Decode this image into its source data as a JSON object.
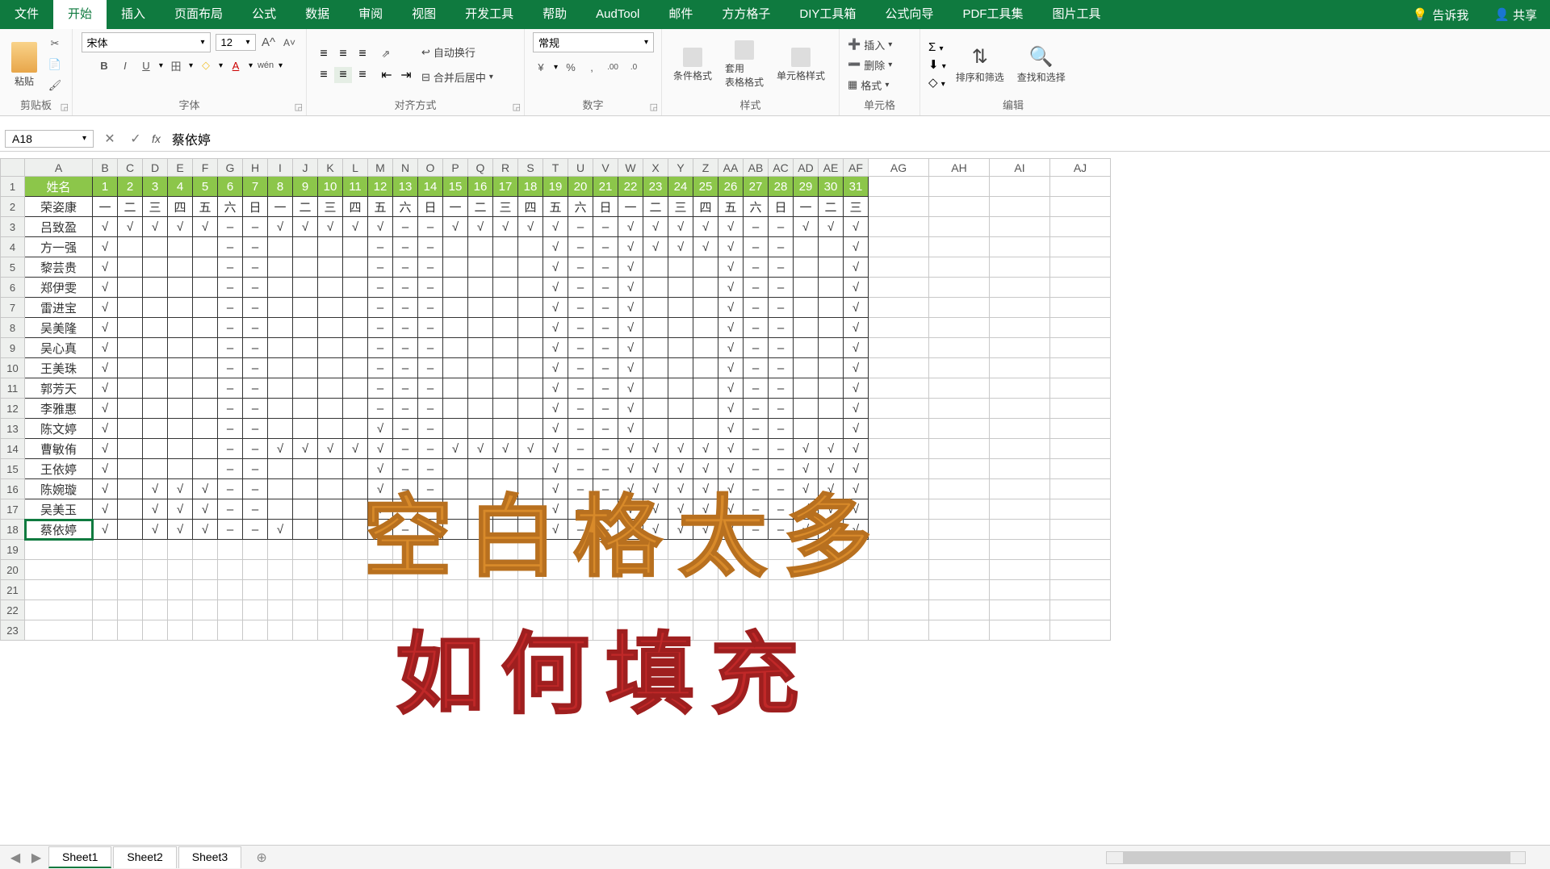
{
  "menutabs": [
    "文件",
    "开始",
    "插入",
    "页面布局",
    "公式",
    "数据",
    "审阅",
    "视图",
    "开发工具",
    "帮助",
    "AudTool",
    "邮件",
    "方方格子",
    "DIY工具箱",
    "公式向导",
    "PDF工具集",
    "图片工具"
  ],
  "activeTab": "开始",
  "tellme": "告诉我",
  "share": "共享",
  "ribbon": {
    "clipboard": {
      "label": "剪贴板",
      "paste": "粘贴"
    },
    "font": {
      "label": "字体",
      "name": "宋体",
      "size": "12"
    },
    "align": {
      "label": "对齐方式",
      "wrap": "自动换行",
      "merge": "合并后居中"
    },
    "number": {
      "label": "数字",
      "format": "常规"
    },
    "styles": {
      "label": "样式",
      "cond": "条件格式",
      "table": "套用\n表格格式",
      "cell": "单元格样式"
    },
    "cells": {
      "label": "单元格",
      "insert": "插入",
      "delete": "删除",
      "format": "格式"
    },
    "edit": {
      "label": "编辑",
      "sort": "排序和筛选",
      "find": "查找和选择"
    }
  },
  "namebox": "A18",
  "formula": "蔡依婷",
  "colLetters": [
    "A",
    "B",
    "C",
    "D",
    "E",
    "F",
    "G",
    "H",
    "I",
    "J",
    "K",
    "L",
    "M",
    "N",
    "O",
    "P",
    "Q",
    "R",
    "S",
    "T",
    "U",
    "V",
    "W",
    "X",
    "Y",
    "Z",
    "AA",
    "AB",
    "AC",
    "AD",
    "AE",
    "AF",
    "AG",
    "AH",
    "AI",
    "AJ"
  ],
  "header": {
    "name": "姓名",
    "days": [
      "1",
      "2",
      "3",
      "4",
      "5",
      "6",
      "7",
      "8",
      "9",
      "10",
      "11",
      "12",
      "13",
      "14",
      "15",
      "16",
      "17",
      "18",
      "19",
      "20",
      "21",
      "22",
      "23",
      "24",
      "25",
      "26",
      "27",
      "28",
      "29",
      "30",
      "31"
    ]
  },
  "weekdays": [
    "一",
    "二",
    "三",
    "四",
    "五",
    "六",
    "日",
    "一",
    "二",
    "三",
    "四",
    "五",
    "六",
    "日",
    "一",
    "二",
    "三",
    "四",
    "五",
    "六",
    "日",
    "一",
    "二",
    "三",
    "四",
    "五",
    "六",
    "日",
    "一",
    "二",
    "三"
  ],
  "tick": "√",
  "dash": "–",
  "rows": [
    {
      "num": 2,
      "name": "荣姿康",
      "cells": [
        "w",
        "w",
        "w",
        "w",
        "w",
        "w",
        "w",
        "w",
        "w",
        "w",
        "w",
        "w",
        "w",
        "w",
        "w",
        "w",
        "w",
        "w",
        "w",
        "w",
        "w",
        "w",
        "w",
        "w",
        "w",
        "w",
        "w",
        "w",
        "w",
        "w",
        "w"
      ]
    },
    {
      "num": 3,
      "name": "吕致盈",
      "cells": [
        "t",
        "t",
        "t",
        "t",
        "t",
        "d",
        "d",
        "t",
        "t",
        "t",
        "t",
        "t",
        "d",
        "d",
        "t",
        "t",
        "t",
        "t",
        "t",
        "d",
        "d",
        "t",
        "t",
        "t",
        "t",
        "t",
        "d",
        "d",
        "t",
        "t",
        "t"
      ]
    },
    {
      "num": 4,
      "name": "方一强",
      "cells": [
        "t",
        "",
        "",
        "",
        "",
        "d",
        "d",
        "",
        "",
        "",
        "",
        "d",
        "d",
        "d",
        "",
        "",
        "",
        "",
        "t",
        "d",
        "d",
        "t",
        "t",
        "t",
        "t",
        "t",
        "d",
        "d",
        "",
        "",
        "t"
      ]
    },
    {
      "num": 5,
      "name": "黎芸贵",
      "cells": [
        "t",
        "",
        "",
        "",
        "",
        "d",
        "d",
        "",
        "",
        "",
        "",
        "d",
        "d",
        "d",
        "",
        "",
        "",
        "",
        "t",
        "d",
        "d",
        "t",
        "",
        "",
        "",
        "t",
        "d",
        "d",
        "",
        "",
        "t"
      ]
    },
    {
      "num": 6,
      "name": "郑伊雯",
      "cells": [
        "t",
        "",
        "",
        "",
        "",
        "d",
        "d",
        "",
        "",
        "",
        "",
        "d",
        "d",
        "d",
        "",
        "",
        "",
        "",
        "t",
        "d",
        "d",
        "t",
        "",
        "",
        "",
        "t",
        "d",
        "d",
        "",
        "",
        "t"
      ]
    },
    {
      "num": 7,
      "name": "雷进宝",
      "cells": [
        "t",
        "",
        "",
        "",
        "",
        "d",
        "d",
        "",
        "",
        "",
        "",
        "d",
        "d",
        "d",
        "",
        "",
        "",
        "",
        "t",
        "d",
        "d",
        "t",
        "",
        "",
        "",
        "t",
        "d",
        "d",
        "",
        "",
        "t"
      ]
    },
    {
      "num": 8,
      "name": "吴美隆",
      "cells": [
        "t",
        "",
        "",
        "",
        "",
        "d",
        "d",
        "",
        "",
        "",
        "",
        "d",
        "d",
        "d",
        "",
        "",
        "",
        "",
        "t",
        "d",
        "d",
        "t",
        "",
        "",
        "",
        "t",
        "d",
        "d",
        "",
        "",
        "t"
      ]
    },
    {
      "num": 9,
      "name": "吴心真",
      "cells": [
        "t",
        "",
        "",
        "",
        "",
        "d",
        "d",
        "",
        "",
        "",
        "",
        "d",
        "d",
        "d",
        "",
        "",
        "",
        "",
        "t",
        "d",
        "d",
        "t",
        "",
        "",
        "",
        "t",
        "d",
        "d",
        "",
        "",
        "t"
      ]
    },
    {
      "num": 10,
      "name": "王美珠",
      "cells": [
        "t",
        "",
        "",
        "",
        "",
        "d",
        "d",
        "",
        "",
        "",
        "",
        "d",
        "d",
        "d",
        "",
        "",
        "",
        "",
        "t",
        "d",
        "d",
        "t",
        "",
        "",
        "",
        "t",
        "d",
        "d",
        "",
        "",
        "t"
      ]
    },
    {
      "num": 11,
      "name": "郭芳天",
      "cells": [
        "t",
        "",
        "",
        "",
        "",
        "d",
        "d",
        "",
        "",
        "",
        "",
        "d",
        "d",
        "d",
        "",
        "",
        "",
        "",
        "t",
        "d",
        "d",
        "t",
        "",
        "",
        "",
        "t",
        "d",
        "d",
        "",
        "",
        "t"
      ]
    },
    {
      "num": 12,
      "name": "李雅惠",
      "cells": [
        "t",
        "",
        "",
        "",
        "",
        "d",
        "d",
        "",
        "",
        "",
        "",
        "d",
        "d",
        "d",
        "",
        "",
        "",
        "",
        "t",
        "d",
        "d",
        "t",
        "",
        "",
        "",
        "t",
        "d",
        "d",
        "",
        "",
        "t"
      ]
    },
    {
      "num": 13,
      "name": "陈文婷",
      "cells": [
        "t",
        "",
        "",
        "",
        "",
        "d",
        "d",
        "",
        "",
        "",
        "",
        "t",
        "d",
        "d",
        "",
        "",
        "",
        "",
        "t",
        "d",
        "d",
        "t",
        "",
        "",
        "",
        "t",
        "d",
        "d",
        "",
        "",
        "t"
      ]
    },
    {
      "num": 14,
      "name": "曹敏侑",
      "cells": [
        "t",
        "",
        "",
        "",
        "",
        "d",
        "d",
        "t",
        "t",
        "t",
        "t",
        "t",
        "d",
        "d",
        "t",
        "t",
        "t",
        "t",
        "t",
        "d",
        "d",
        "t",
        "t",
        "t",
        "t",
        "t",
        "d",
        "d",
        "t",
        "t",
        "t"
      ]
    },
    {
      "num": 15,
      "name": "王依婷",
      "cells": [
        "t",
        "",
        "",
        "",
        "",
        "d",
        "d",
        "",
        "",
        "",
        "",
        "t",
        "d",
        "d",
        "",
        "",
        "",
        "",
        "t",
        "d",
        "d",
        "t",
        "t",
        "t",
        "t",
        "t",
        "d",
        "d",
        "t",
        "t",
        "t"
      ]
    },
    {
      "num": 16,
      "name": "陈婉璇",
      "cells": [
        "t",
        "",
        "t",
        "t",
        "t",
        "d",
        "d",
        "",
        "",
        "",
        "",
        "t",
        "d",
        "d",
        "",
        "",
        "",
        "",
        "t",
        "d",
        "d",
        "t",
        "t",
        "t",
        "t",
        "t",
        "d",
        "d",
        "t",
        "t",
        "t"
      ]
    },
    {
      "num": 17,
      "name": "吴美玉",
      "cells": [
        "t",
        "",
        "t",
        "t",
        "t",
        "d",
        "d",
        "",
        "",
        "",
        "",
        "t",
        "d",
        "d",
        "",
        "",
        "",
        "",
        "t",
        "d",
        "d",
        "t",
        "t",
        "t",
        "t",
        "t",
        "d",
        "d",
        "t",
        "t",
        "t"
      ]
    },
    {
      "num": 18,
      "name": "蔡依婷",
      "cells": [
        "t",
        "",
        "t",
        "t",
        "t",
        "d",
        "d",
        "t",
        "",
        "",
        "",
        "t",
        "d",
        "d",
        "",
        "",
        "",
        "",
        "t",
        "d",
        "d",
        "t",
        "t",
        "t",
        "t",
        "t",
        "d",
        "d",
        "t",
        "t",
        "t"
      ]
    }
  ],
  "emptyRows": [
    19,
    20,
    21,
    22,
    23
  ],
  "overlay1": "空白格太多",
  "overlay2": "如何填充",
  "sheets": [
    "Sheet1",
    "Sheet2",
    "Sheet3"
  ]
}
